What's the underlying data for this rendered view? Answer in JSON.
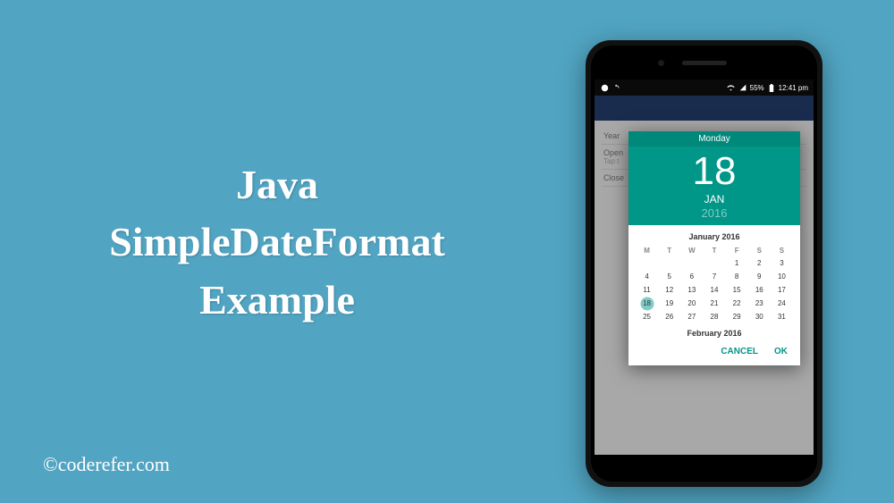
{
  "title": {
    "line1": "Java",
    "line2": "SimpleDateFormat",
    "line3": "Example"
  },
  "copyright": "©coderefer.com",
  "statusBar": {
    "battery": "55%",
    "time": "12:41 pm"
  },
  "backgroundForm": {
    "item1": "Year",
    "item2": "Open",
    "item2sub": "Tap t",
    "item3": "Close"
  },
  "datePicker": {
    "weekday": "Monday",
    "day": "18",
    "month": "JAN",
    "year": "2016",
    "calendarTitle": "January 2016",
    "dowHeaders": [
      "M",
      "T",
      "W",
      "T",
      "F",
      "S",
      "S"
    ],
    "weeks": [
      [
        "",
        "",
        "",
        "",
        "1",
        "2",
        "3"
      ],
      [
        "4",
        "5",
        "6",
        "7",
        "8",
        "9",
        "10"
      ],
      [
        "11",
        "12",
        "13",
        "14",
        "15",
        "16",
        "17"
      ],
      [
        "18",
        "19",
        "20",
        "21",
        "22",
        "23",
        "24"
      ],
      [
        "25",
        "26",
        "27",
        "28",
        "29",
        "30",
        "31"
      ]
    ],
    "selectedDay": "18",
    "nextMonthTitle": "February 2016",
    "cancelLabel": "CANCEL",
    "okLabel": "OK"
  }
}
